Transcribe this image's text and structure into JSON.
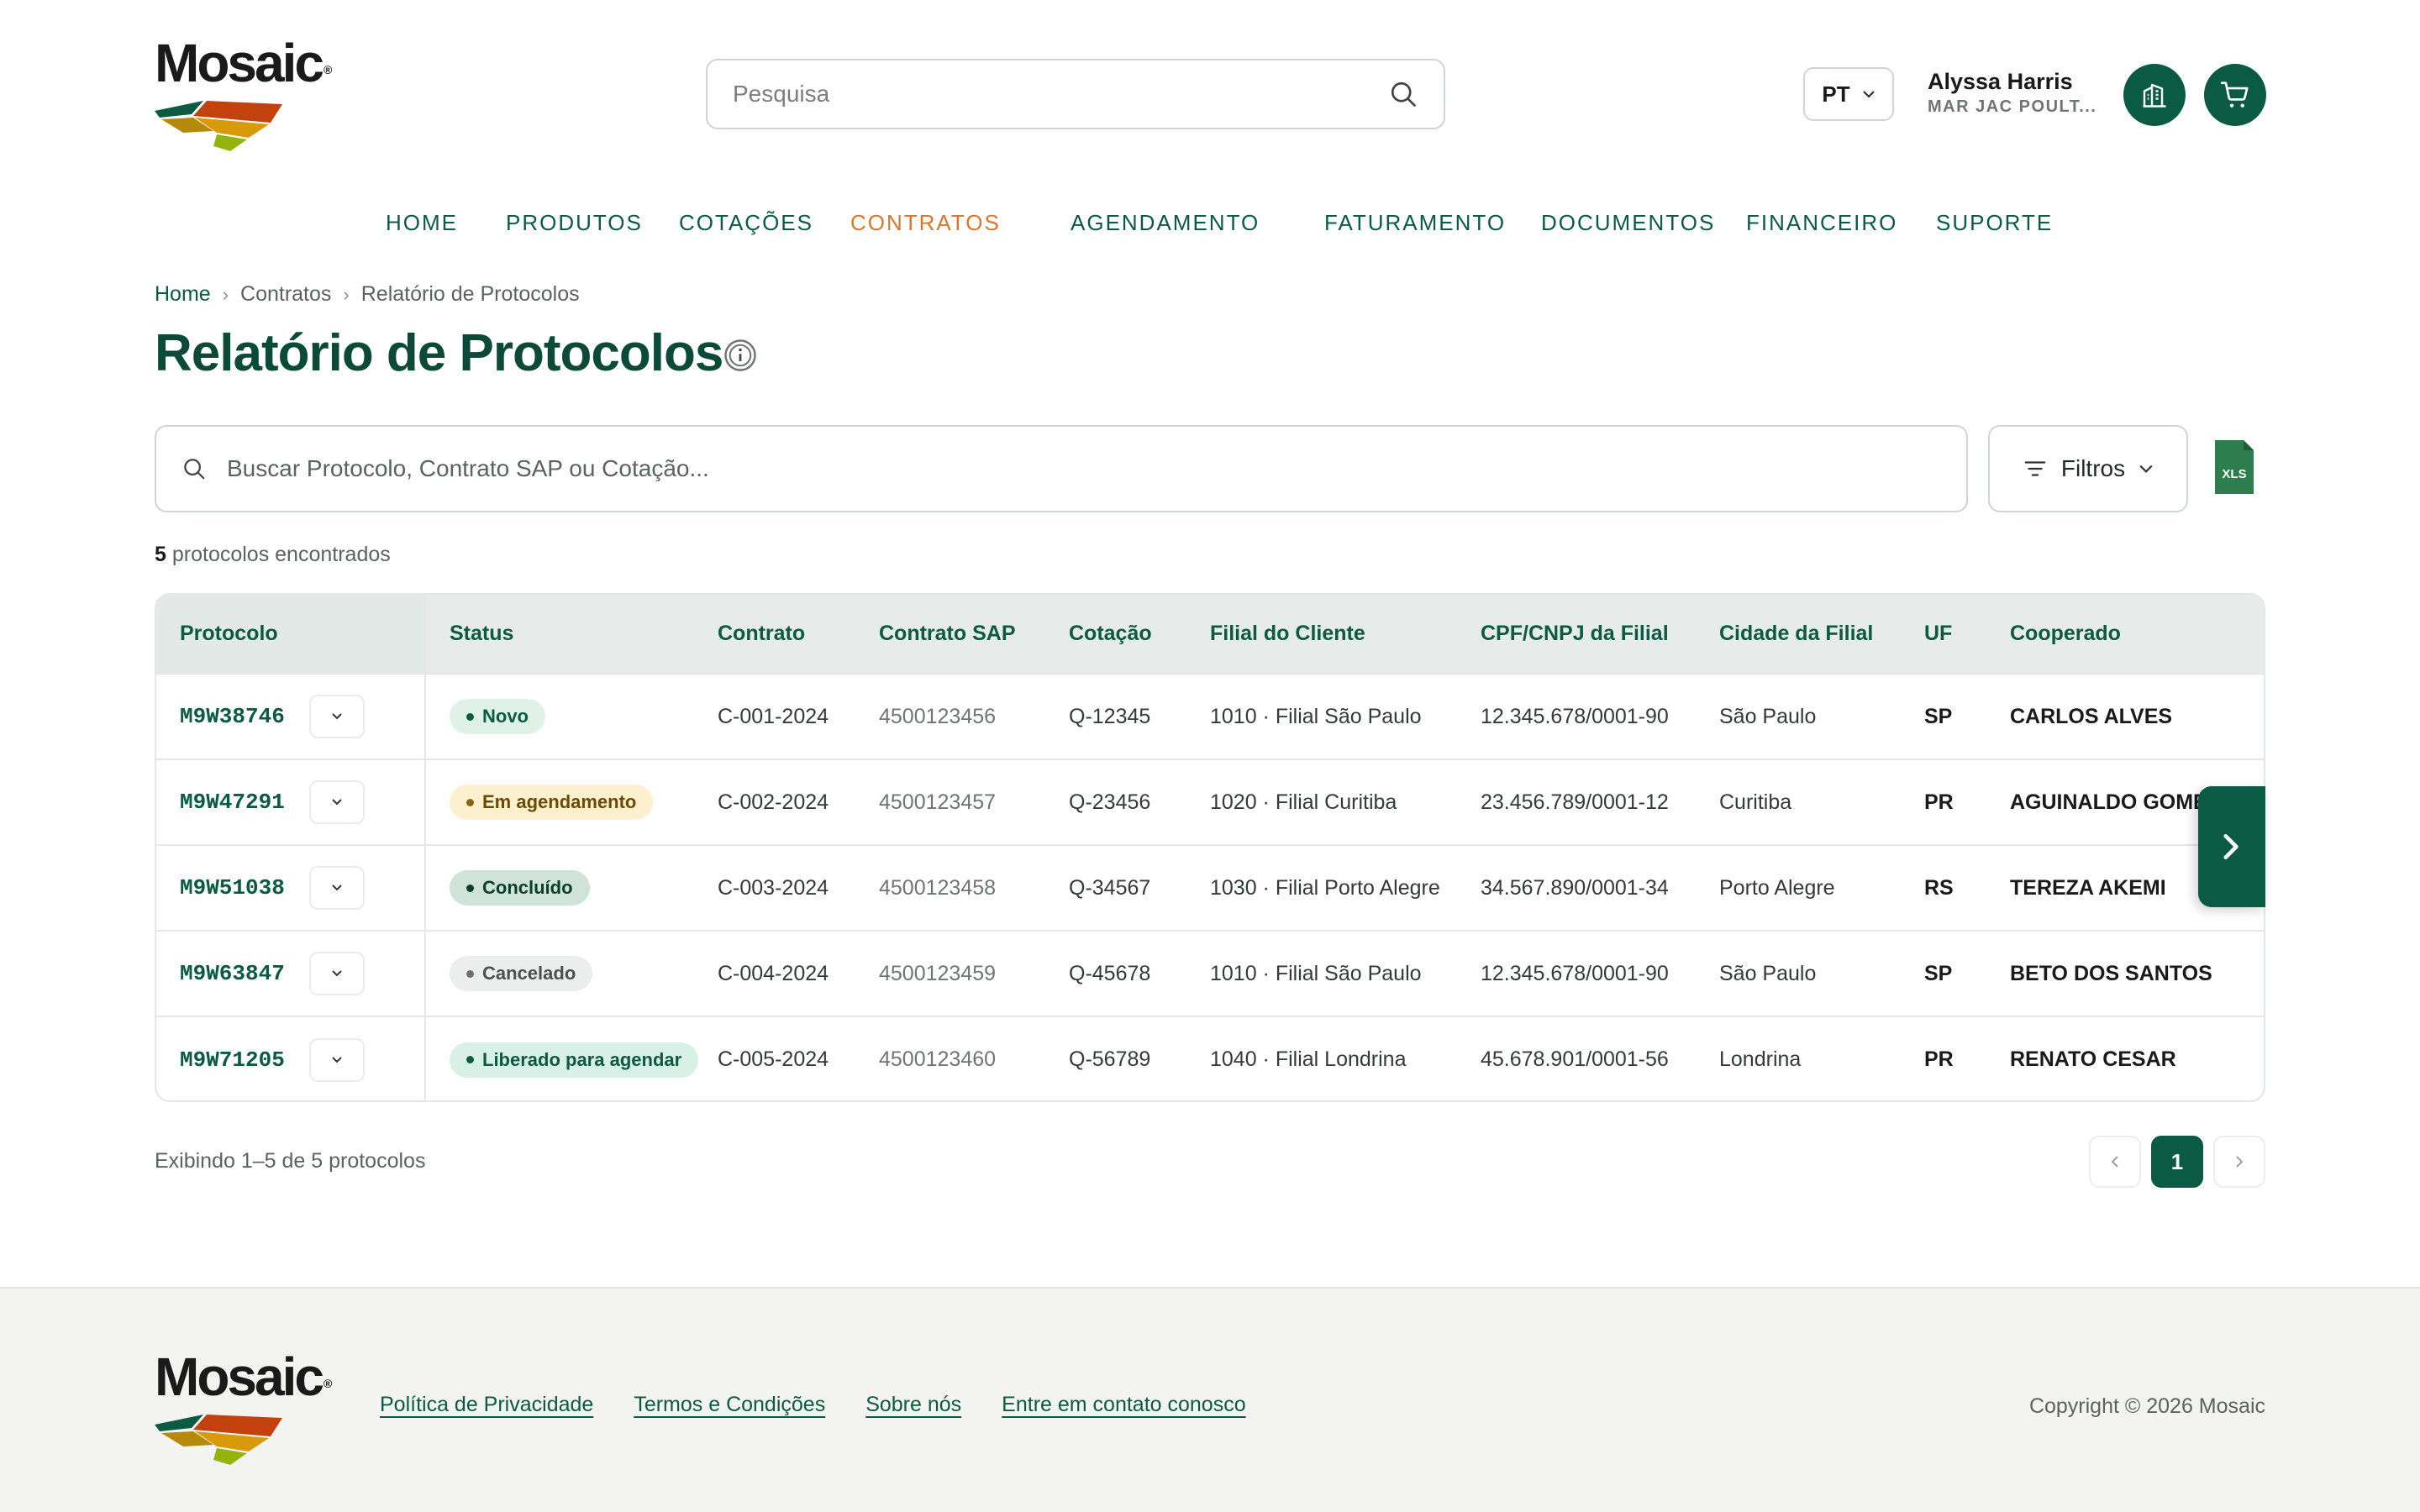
{
  "brand": {
    "name": "Mosaic",
    "reg": "®"
  },
  "header": {
    "search_placeholder": "Pesquisa",
    "language": "PT",
    "user_name": "Alyssa Harris",
    "user_company": "MAR JAC POULT..."
  },
  "nav": [
    {
      "label": "HOME"
    },
    {
      "label": "PRODUTOS"
    },
    {
      "label": "COTAÇÕES"
    },
    {
      "label": "CONTRATOS",
      "active": true
    },
    {
      "label": "AGENDAMENTO"
    },
    {
      "label": "FATURAMENTO"
    },
    {
      "label": "DOCUMENTOS"
    },
    {
      "label": "FINANCEIRO"
    },
    {
      "label": "SUPORTE"
    }
  ],
  "breadcrumb": [
    "Home",
    "Contratos",
    "Relatório de Protocolos"
  ],
  "page": {
    "title": "Relatório de Protocolos",
    "search_placeholder": "Buscar Protocolo, Contrato SAP ou Cotação...",
    "filters_label": "Filtros",
    "xls_label": "XLS",
    "results_count": "5",
    "results_text": "protocolos encontrados",
    "showing": "Exibindo 1–5 de 5 protocolos",
    "current_page": "1"
  },
  "table": {
    "columns": [
      "Protocolo",
      "Status",
      "Contrato",
      "Contrato SAP",
      "Cotação",
      "Filial do Cliente",
      "CPF/CNPJ da Filial",
      "Cidade da Filial",
      "UF",
      "Cooperado"
    ],
    "rows": [
      {
        "protocolo": "M9W38746",
        "status": "Novo",
        "contrato": "C-001-2024",
        "sap": "4500123456",
        "cotacao": "Q-12345",
        "filial": "1010 · Filial São Paulo",
        "cnpj": "12.345.678/0001-90",
        "cidade": "São Paulo",
        "uf": "SP",
        "cooperado": "CARLOS ALVES"
      },
      {
        "protocolo": "M9W47291",
        "status": "Em agendamento",
        "contrato": "C-002-2024",
        "sap": "4500123457",
        "cotacao": "Q-23456",
        "filial": "1020 · Filial Curitiba",
        "cnpj": "23.456.789/0001-12",
        "cidade": "Curitiba",
        "uf": "PR",
        "cooperado": "AGUINALDO GOMES"
      },
      {
        "protocolo": "M9W51038",
        "status": "Concluído",
        "contrato": "C-003-2024",
        "sap": "4500123458",
        "cotacao": "Q-34567",
        "filial": "1030 · Filial Porto Alegre",
        "cnpj": "34.567.890/0001-34",
        "cidade": "Porto Alegre",
        "uf": "RS",
        "cooperado": "TEREZA AKEMI"
      },
      {
        "protocolo": "M9W63847",
        "status": "Cancelado",
        "contrato": "C-004-2024",
        "sap": "4500123459",
        "cotacao": "Q-45678",
        "filial": "1010 · Filial São Paulo",
        "cnpj": "12.345.678/0001-90",
        "cidade": "São Paulo",
        "uf": "SP",
        "cooperado": "BETO DOS SANTOS"
      },
      {
        "protocolo": "M9W71205",
        "status": "Liberado para agendar",
        "contrato": "C-005-2024",
        "sap": "4500123460",
        "cotacao": "Q-56789",
        "filial": "1040 · Filial Londrina",
        "cnpj": "45.678.901/0001-56",
        "cidade": "Londrina",
        "uf": "PR",
        "cooperado": "RENATO CESAR"
      }
    ]
  },
  "footer": {
    "links": [
      "Política de Privacidade",
      "Termos e Condições",
      "Sobre nós",
      "Entre em contato conosco"
    ],
    "copyright": "Copyright © 2026 Mosaic"
  },
  "colors": {
    "primary": "#0b5a43",
    "accent": "#d9772e",
    "xls": "#2e7d4f"
  }
}
